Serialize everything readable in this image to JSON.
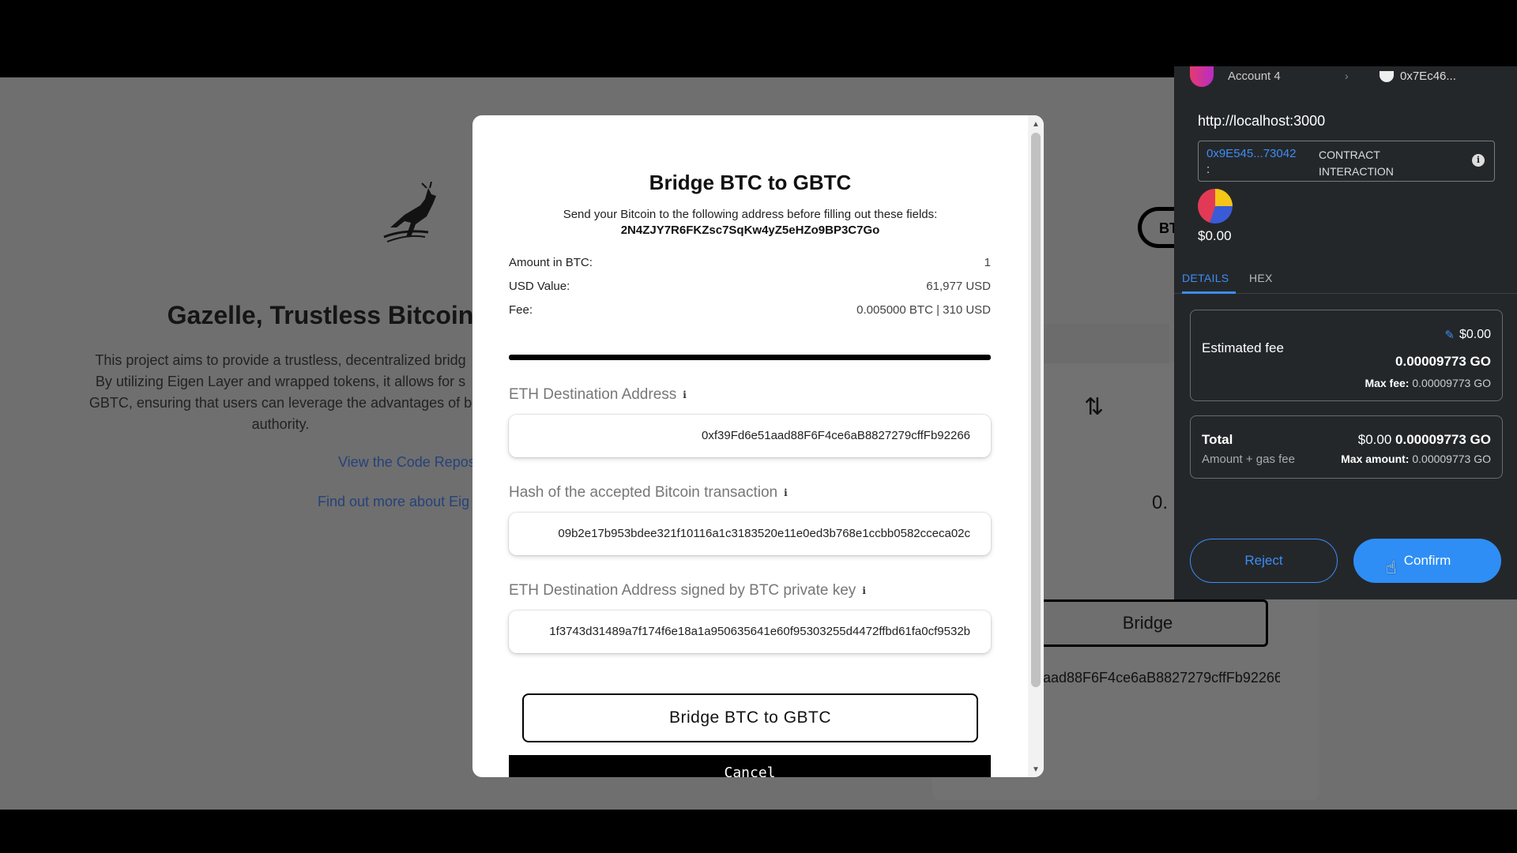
{
  "background": {
    "title": "Gazelle, Trustless Bitcoin-",
    "description_lines": [
      "This project aims to provide a trustless, decentralized bridg",
      "By utilizing Eigen Layer and wrapped tokens, it allows for s",
      "GBTC, ensuring that users can leverage the advantages of b",
      "authority."
    ],
    "link_code": "View the Code Repos",
    "link_eigen": "Find out more about Eig",
    "token_pill": "BT",
    "swap_icon": "swap-vertical-icon",
    "amount_partial": "0.",
    "bridge_button": "Bridge",
    "address_partial": "aad88F6F4ce6aB8827279cffFb92266"
  },
  "modal": {
    "title": "Bridge BTC to GBTC",
    "instruction": "Send your Bitcoin to the following address before filling out these fields:",
    "btc_address": "2N4ZJY7R6FKZsc7SqKw4yZ5eHZo9BP3C7Go",
    "summary": [
      {
        "label": "Amount in BTC:",
        "value": "1"
      },
      {
        "label": "USD Value:",
        "value": "61,977 USD"
      },
      {
        "label": "Fee:",
        "value": "0.005000 BTC | 310 USD"
      }
    ],
    "fields": {
      "eth_address": {
        "label": "ETH Destination Address",
        "value": "0xf39Fd6e51aad88F6F4ce6aB8827279cffFb92266"
      },
      "btc_tx_hash": {
        "label": "Hash of the accepted Bitcoin transaction",
        "value": "09b2e17b953bdee321f10116a1c3183520e11e0ed3b768e1ccbb0582cceca02c"
      },
      "signed_address": {
        "label": "ETH Destination Address signed by BTC private key",
        "value": "1f3743d31489a7f174f6e18a1a950635641e60f95303255d4472ffbd61fa0cf9532b"
      }
    },
    "info_glyph": "i",
    "primary_button": "Bridge BTC to GBTC",
    "cancel_button": "Cancel"
  },
  "wallet": {
    "account": "Account 4",
    "network": "0x7Ec46...",
    "origin": "http://localhost:3000",
    "contract_address": "0x9E545...73042",
    "contract_colon": ":",
    "interaction_line1": "CONTRACT",
    "interaction_line2": "INTERACTION",
    "balance": "$0.00",
    "tabs": [
      "DETAILS",
      "HEX"
    ],
    "estimated_fee_label": "Estimated fee",
    "estimated_fee_usd": "$0.00",
    "estimated_fee_go": "0.00009773 GO",
    "max_fee_label": "Max fee:",
    "max_fee_value": "0.00009773 GO",
    "total_label": "Total",
    "total_usd": "$0.00",
    "total_go": "0.00009773 GO",
    "total_sub": "Amount + gas fee",
    "max_amount_label": "Max amount:",
    "max_amount_value": "0.00009773 GO",
    "reject_button": "Reject",
    "confirm_button": "Confirm"
  },
  "colors": {
    "accent_blue": "#3d8df5",
    "wallet_bg": "#24272a",
    "overlay": "#6f6f6f"
  }
}
